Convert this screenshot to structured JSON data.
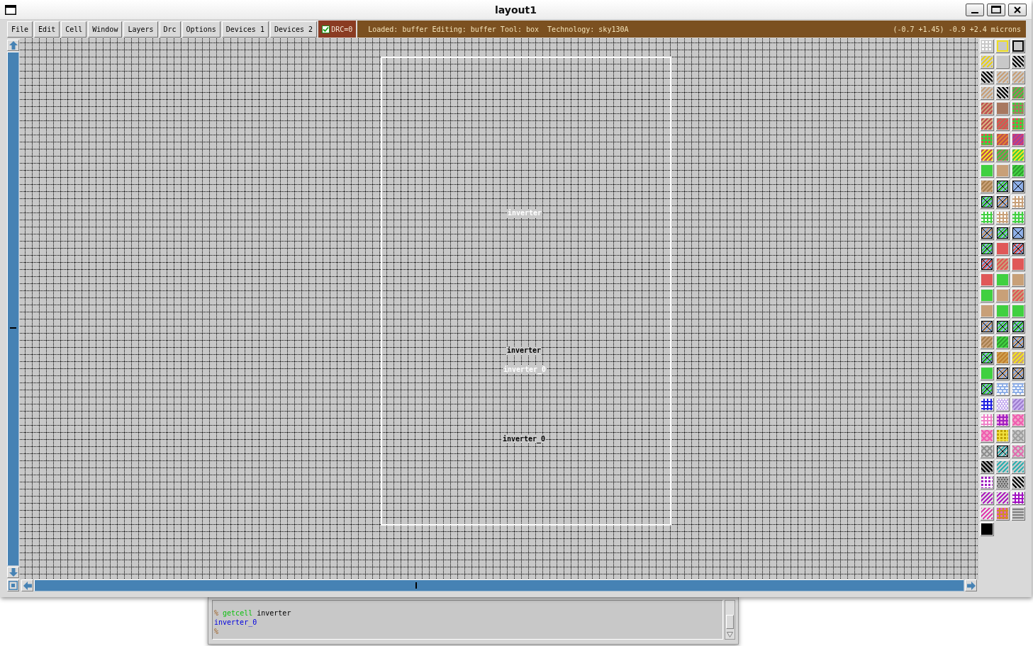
{
  "window": {
    "title": "layout1"
  },
  "menu": [
    "File",
    "Edit",
    "Cell",
    "Window",
    "Layers",
    "Drc",
    "Options",
    "Devices 1",
    "Devices 2"
  ],
  "drc": {
    "label": "DRC=0",
    "checked": true
  },
  "status": {
    "text": "Loaded: buffer Editing: buffer Tool: box  Technology: sky130A",
    "coordinates": "(-0.7 +1.45) -0.9 +2.4 microns"
  },
  "canvas": {
    "labels": [
      {
        "text": "inverter",
        "color": "#ffffff"
      },
      {
        "text": "inverter",
        "color": "#000000"
      },
      {
        "text": "inverter_0",
        "color": "#ffffff"
      },
      {
        "text": "inverter_0",
        "color": "#000000"
      }
    ]
  },
  "palette": {
    "tiles": [
      {
        "color": "#c8c8c8",
        "pattern": {
          "kind": "grid",
          "color": "#ffffff"
        }
      },
      {
        "color": "#c8c8c8",
        "pattern": {
          "kind": "outline",
          "color": "#f0e020"
        }
      },
      {
        "color": "#c8c8c8",
        "pattern": {
          "kind": "outline",
          "color": "#000000"
        }
      },
      {
        "color": "#c8c8c8",
        "pattern": {
          "kind": "slash",
          "color": "#e8d020"
        }
      },
      {
        "color": "#c8c8c8"
      },
      {
        "color": "#c8c8c8",
        "pattern": {
          "kind": "backslash",
          "color": "#000000"
        }
      },
      {
        "color": "#c8c8c8",
        "pattern": {
          "kind": "backslash",
          "color": "#000000"
        }
      },
      {
        "color": "#c8c8c8",
        "pattern": {
          "kind": "slash",
          "color": "#c8a078"
        }
      },
      {
        "color": "#c8c8c8",
        "pattern": {
          "kind": "slash",
          "color": "#c8a078"
        }
      },
      {
        "color": "#c8c8c8",
        "pattern": {
          "kind": "slash",
          "color": "#c8a078"
        }
      },
      {
        "color": "#c8c8c8",
        "pattern": {
          "kind": "backslash",
          "color": "#000000"
        }
      },
      {
        "color": "#a87860",
        "pattern": {
          "kind": "slash",
          "color": "#40c040"
        }
      },
      {
        "color": "#c05050",
        "pattern": {
          "kind": "slash",
          "color": "#c8a078"
        }
      },
      {
        "color": "#a87860"
      },
      {
        "color": "#a87860",
        "pattern": {
          "kind": "dots",
          "color": "#40d040"
        }
      },
      {
        "color": "#c05050",
        "pattern": {
          "kind": "slash",
          "color": "#d8b080"
        }
      },
      {
        "color": "#a87860",
        "pattern": {
          "kind": "slash",
          "color": "#e05050"
        }
      },
      {
        "color": "#40d040",
        "pattern": {
          "kind": "dots",
          "color": "#e05050"
        }
      },
      {
        "color": "#40d040",
        "pattern": {
          "kind": "dots",
          "color": "#e05050"
        }
      },
      {
        "color": "#c05050",
        "pattern": {
          "kind": "slash",
          "color": "#e08030"
        }
      },
      {
        "color": "#d04070",
        "pattern": {
          "kind": "slash",
          "color": "#a040a0"
        }
      },
      {
        "color": "#c05050",
        "pattern": {
          "kind": "slash",
          "color": "#f0e020"
        }
      },
      {
        "color": "#a87860",
        "pattern": {
          "kind": "slash",
          "color": "#40c040"
        }
      },
      {
        "color": "#40d040",
        "pattern": {
          "kind": "slash",
          "color": "#f0e020"
        }
      },
      {
        "color": "#40d040"
      },
      {
        "color": "#c8a078"
      },
      {
        "color": "#40d040",
        "pattern": {
          "kind": "slash",
          "color": "#30a030"
        }
      },
      {
        "color": "#c8a078",
        "pattern": {
          "kind": "slash",
          "color": "#a88050"
        }
      },
      {
        "color": "#90b0e8",
        "pattern": {
          "kind": "contact",
          "color": "#40d040"
        }
      },
      {
        "color": "#90b0e8",
        "pattern": {
          "kind": "contact"
        }
      },
      {
        "color": "#90b0e8",
        "pattern": {
          "kind": "contact",
          "color": "#40d040"
        }
      },
      {
        "color": "#90b0e8",
        "pattern": {
          "kind": "contact",
          "color": "#c8a078"
        }
      },
      {
        "color": "#c8a078",
        "pattern": {
          "kind": "dots",
          "color": "#ffffff"
        }
      },
      {
        "color": "#40d040",
        "pattern": {
          "kind": "dots",
          "color": "#ffffff"
        }
      },
      {
        "color": "#c8a078",
        "pattern": {
          "kind": "dots",
          "color": "#ffffff"
        }
      },
      {
        "color": "#40d040",
        "pattern": {
          "kind": "dots",
          "color": "#e0f0e0"
        }
      },
      {
        "color": "#90b0e8",
        "pattern": {
          "kind": "contact",
          "color": "#c8a078"
        }
      },
      {
        "color": "#90b0e8",
        "pattern": {
          "kind": "contact",
          "color": "#40d040"
        }
      },
      {
        "color": "#90b0e8",
        "pattern": {
          "kind": "contact"
        }
      },
      {
        "color": "#90b0e8",
        "pattern": {
          "kind": "contact",
          "color": "#40d040"
        }
      },
      {
        "color": "#e05858"
      },
      {
        "color": "#90b0e8",
        "pattern": {
          "kind": "contact",
          "color": "#e05858"
        }
      },
      {
        "color": "#90b0e8",
        "pattern": {
          "kind": "contact",
          "color": "#e05858"
        }
      },
      {
        "color": "#e05858",
        "pattern": {
          "kind": "slash",
          "color": "#c8a078"
        }
      },
      {
        "color": "#e05858"
      },
      {
        "color": "#e05858"
      },
      {
        "color": "#40d040"
      },
      {
        "color": "#c8a078"
      },
      {
        "color": "#40d040"
      },
      {
        "color": "#c8a078"
      },
      {
        "color": "#e05858",
        "pattern": {
          "kind": "slash",
          "color": "#c8a078"
        }
      },
      {
        "color": "#c8a078"
      },
      {
        "color": "#40d040"
      },
      {
        "color": "#40d040"
      },
      {
        "color": "#90b0e8",
        "pattern": {
          "kind": "contact",
          "color": "#c8a078"
        }
      },
      {
        "color": "#90b0e8",
        "pattern": {
          "kind": "contact",
          "color": "#40d040"
        }
      },
      {
        "color": "#90b0e8",
        "pattern": {
          "kind": "contact",
          "color": "#40d040"
        }
      },
      {
        "color": "#c8a078",
        "pattern": {
          "kind": "slash",
          "color": "#a88050"
        }
      },
      {
        "color": "#40d040",
        "pattern": {
          "kind": "slash",
          "color": "#30a030"
        }
      },
      {
        "color": "#90b0e8",
        "pattern": {
          "kind": "contact",
          "color": "#c8a078"
        }
      },
      {
        "color": "#90b0e8",
        "pattern": {
          "kind": "contact",
          "color": "#40d040"
        }
      },
      {
        "color": "#d0a050",
        "pattern": {
          "kind": "slash",
          "color": "#c08030"
        }
      },
      {
        "color": "#c8a078",
        "pattern": {
          "kind": "slash",
          "color": "#f0e020"
        }
      },
      {
        "color": "#40d040"
      },
      {
        "color": "#90b0e8",
        "pattern": {
          "kind": "contact",
          "color": "#c8a078"
        }
      },
      {
        "color": "#90b0e8",
        "pattern": {
          "kind": "contact",
          "color": "#c8a078"
        }
      },
      {
        "color": "#90b0e8",
        "pattern": {
          "kind": "contact",
          "color": "#40d040"
        }
      },
      {
        "color": "#90b0e8",
        "pattern": {
          "kind": "dashes",
          "color": "#ffffff"
        }
      },
      {
        "color": "#90b0e8",
        "pattern": {
          "kind": "dashes",
          "color": "#ffffff"
        }
      },
      {
        "color": "#2020e0",
        "pattern": {
          "kind": "dots",
          "color": "#ffffff"
        }
      },
      {
        "color": "#c8b0f0",
        "pattern": {
          "kind": "stipple",
          "color": "#ffffff"
        }
      },
      {
        "color": "#c8b0f0",
        "pattern": {
          "kind": "slash",
          "color": "#a080d0"
        }
      },
      {
        "color": "#f080c8",
        "pattern": {
          "kind": "dots",
          "color": "#ffffff"
        }
      },
      {
        "color": "#a020c0",
        "pattern": {
          "kind": "dots",
          "color": "#f0a0e0"
        }
      },
      {
        "color": "#f0a0c8",
        "pattern": {
          "kind": "cross",
          "color": "#f060b0"
        }
      },
      {
        "color": "#f0a0c8",
        "pattern": {
          "kind": "cross",
          "color": "#f060b0"
        }
      },
      {
        "color": "#f0e040",
        "pattern": {
          "kind": "dots",
          "color": "#c0a000"
        }
      },
      {
        "color": "#c8c8c8",
        "pattern": {
          "kind": "cross",
          "color": "#a0a0a0"
        }
      },
      {
        "color": "#c8c8c8",
        "pattern": {
          "kind": "cross",
          "color": "#909090"
        }
      },
      {
        "color": "#c8c8c8",
        "pattern": {
          "kind": "contact",
          "color": "#40b0b0"
        }
      },
      {
        "color": "#c8c8c8",
        "pattern": {
          "kind": "cross",
          "color": "#e070b0"
        }
      },
      {
        "color": "#a0a0a0",
        "pattern": {
          "kind": "backslash",
          "color": "#000000"
        }
      },
      {
        "color": "#c8c8c8",
        "pattern": {
          "kind": "slash",
          "color": "#30b0b0"
        }
      },
      {
        "color": "#c8c8c8",
        "pattern": {
          "kind": "slash",
          "color": "#30b0b0"
        }
      },
      {
        "color": "#ffffff",
        "pattern": {
          "kind": "dots",
          "color": "#a020c0"
        }
      },
      {
        "color": "#a8a8a8",
        "pattern": {
          "kind": "stipple",
          "color": "#606060"
        }
      },
      {
        "color": "#c8c8c8",
        "pattern": {
          "kind": "backslash",
          "color": "#000000"
        }
      },
      {
        "color": "#e0e0e0",
        "pattern": {
          "kind": "slash",
          "color": "#b020c0"
        }
      },
      {
        "color": "#e0e0e0",
        "pattern": {
          "kind": "slash",
          "color": "#b020c0"
        }
      },
      {
        "color": "#a010c0",
        "pattern": {
          "kind": "dots",
          "color": "#ffffff"
        }
      },
      {
        "color": "#e8e8e8",
        "pattern": {
          "kind": "slash",
          "color": "#e040b0"
        }
      },
      {
        "color": "#d09020",
        "pattern": {
          "kind": "dots",
          "color": "#e060c0"
        }
      },
      {
        "color": "#c8c8c8",
        "pattern": {
          "kind": "hlines",
          "color": "#808080"
        }
      },
      {
        "color": "#000000"
      }
    ]
  },
  "console": {
    "lines": [
      {
        "parts": [
          {
            "kind": "prompt",
            "text": "%"
          },
          {
            "kind": "command",
            "text": "getcell"
          },
          {
            "kind": "argument",
            "text": "inverter"
          }
        ]
      },
      {
        "parts": [
          {
            "kind": "output",
            "text": "inverter_0"
          }
        ]
      },
      {
        "parts": [
          {
            "kind": "prompt",
            "text": "%"
          }
        ]
      }
    ]
  }
}
